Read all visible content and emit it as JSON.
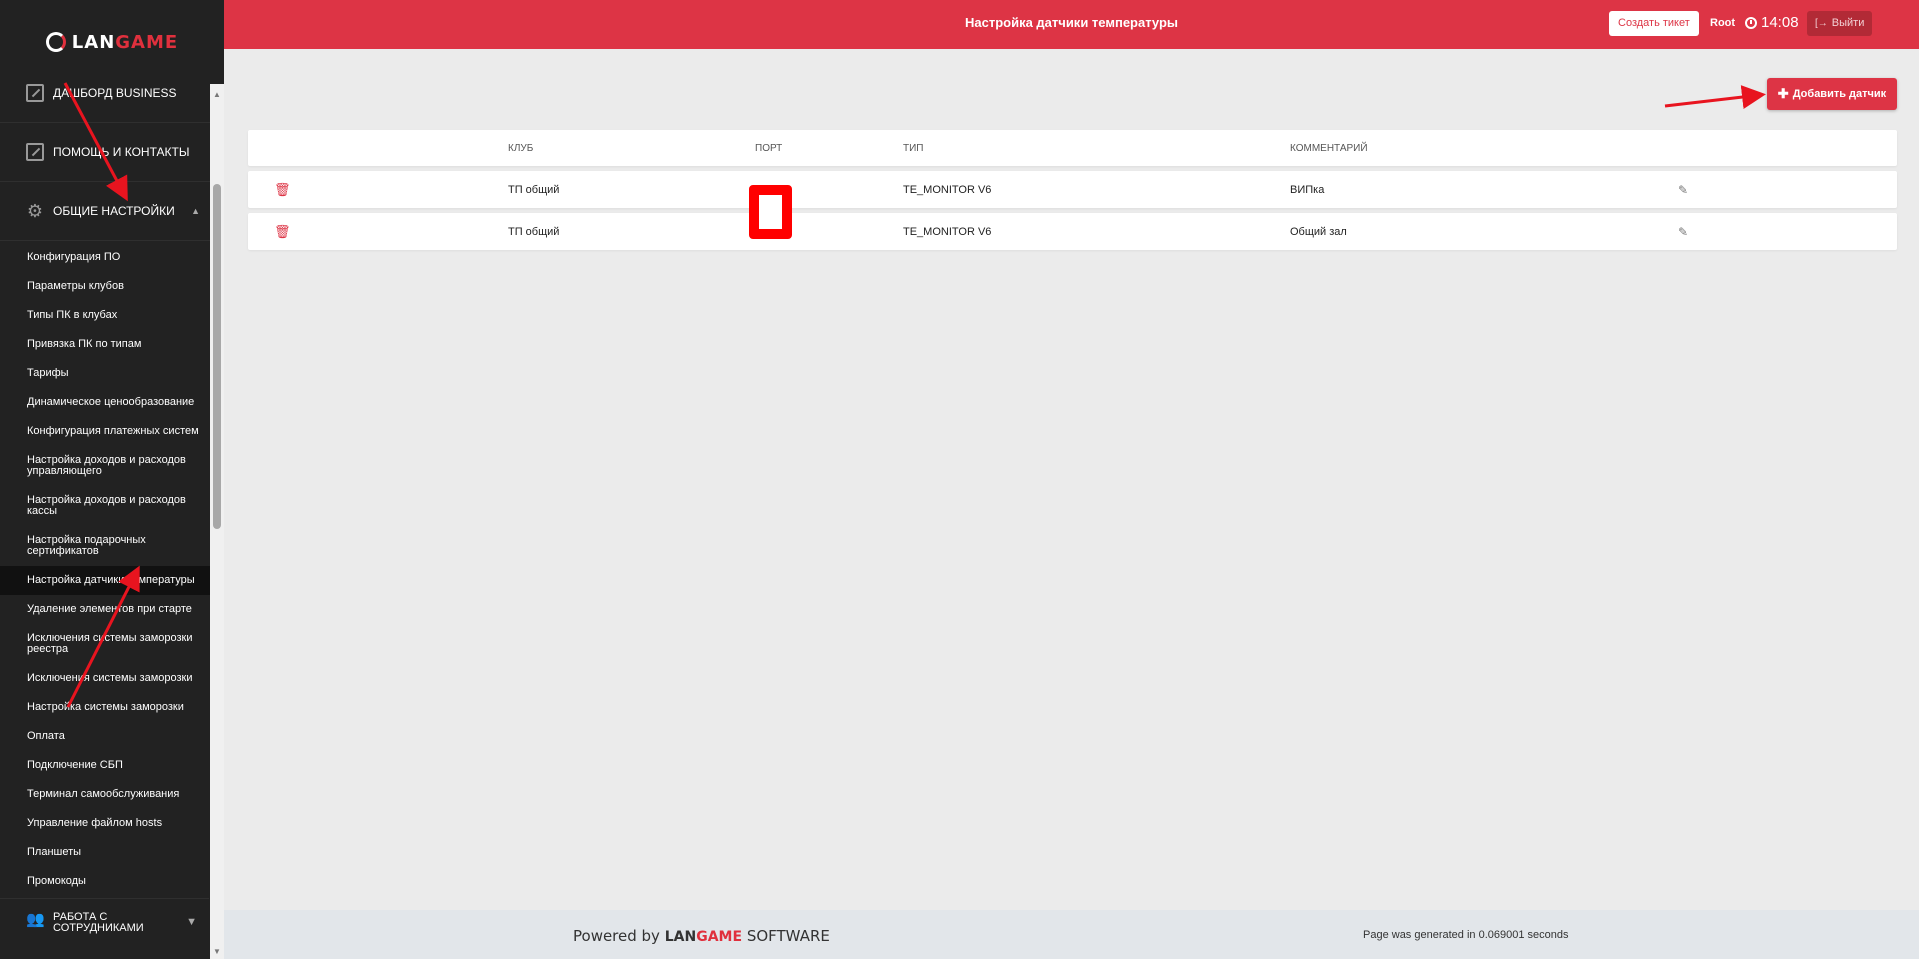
{
  "app": {
    "logo": {
      "part1": "LAN",
      "part2": "GAME"
    },
    "page_title": "Настройка датчики температуры",
    "ticket_button": "Создать тикет",
    "user": "Root",
    "clock": "14:08",
    "logout": "Выйти"
  },
  "sidebar": {
    "sections": [
      {
        "label": "ДАШБОРД BUSINESS"
      },
      {
        "label": "ПОМОЩЬ И КОНТАКТЫ"
      },
      {
        "label": "ОБЩИЕ НАСТРОЙКИ"
      }
    ],
    "items": [
      {
        "label": "Конфигурация ПО"
      },
      {
        "label": "Параметры клубов"
      },
      {
        "label": "Типы ПК в клубах"
      },
      {
        "label": "Привязка ПК по типам"
      },
      {
        "label": "Тарифы"
      },
      {
        "label": "Динамическое ценообразование"
      },
      {
        "label": "Конфигурация платежных систем"
      },
      {
        "label": "Настройка доходов и расходов управляющего"
      },
      {
        "label": "Настройка доходов и расходов кассы"
      },
      {
        "label": "Настройка подарочных сертификатов"
      },
      {
        "label": "Настройка датчики температуры"
      },
      {
        "label": "Удаление элементов при старте"
      },
      {
        "label": "Исключения системы заморозки реестра"
      },
      {
        "label": "Исключения системы заморозки"
      },
      {
        "label": "Настройка системы заморозки"
      },
      {
        "label": "Оплата"
      },
      {
        "label": "Подключение СБП"
      },
      {
        "label": "Терминал самообслуживания"
      },
      {
        "label": "Управление файлом hosts"
      },
      {
        "label": "Планшеты"
      },
      {
        "label": "Промокоды"
      }
    ],
    "bottom_section": "РАБОТА С СОТРУДНИКАМИ"
  },
  "main": {
    "add_button": "Добавить датчик",
    "columns": {
      "club": "КЛУБ",
      "port": "ПОРТ",
      "type": "ТИП",
      "comment": "КОММЕНТАРИЙ"
    },
    "rows": [
      {
        "club": "ТП общий",
        "port": "",
        "type": "TE_MONITOR V6",
        "comment": "ВИПка"
      },
      {
        "club": "ТП общий",
        "port": "",
        "type": "TE_MONITOR V6",
        "comment": "Общий зал"
      }
    ]
  },
  "footer": {
    "powered_prefix": "Powered by",
    "brand_part1": "LAN",
    "brand_part2": "GAME",
    "brand_suffix": "SOFTWARE",
    "generated": "Page was generated in 0.069001 seconds"
  },
  "icons": {
    "trash": "trash-icon",
    "edit": "pencil-icon",
    "settings": "gear-icon",
    "users": "users-icon",
    "clock": "clock-icon",
    "logout": "logout-icon",
    "add": "plus-icon"
  },
  "colors": {
    "brand_red": "#dd3445",
    "sidebar_bg": "#222222",
    "active_item_bg": "#111111",
    "annotation_red": "#ff0000"
  }
}
